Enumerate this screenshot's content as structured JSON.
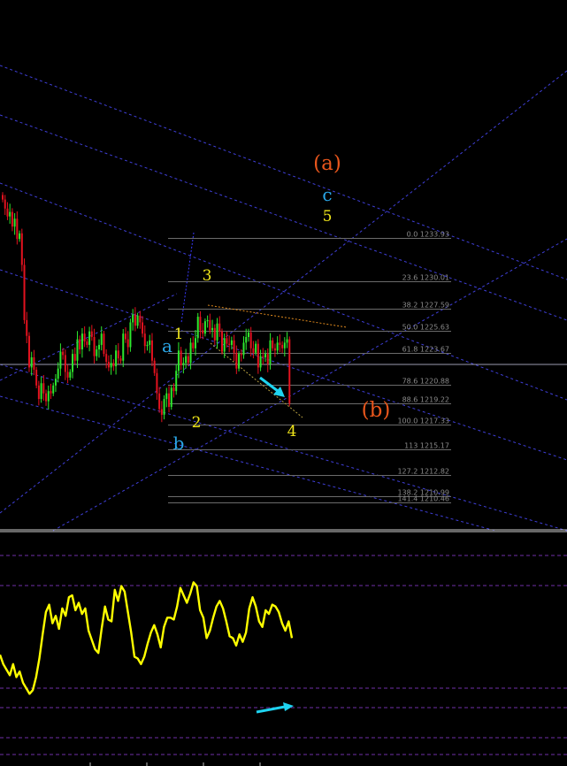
{
  "colors": {
    "background": "#000000",
    "channel": "#3f3fd8",
    "fib": "#6b6b6b",
    "hline": "#9a9ab0",
    "bull": "#2ee82e",
    "bear": "#e3121f",
    "wave_orange": "#e8561c",
    "wave_blue": "#2aa7e8",
    "wave_yellow": "#f0e61a",
    "arrow": "#1ed3f0",
    "oscillator": "#ffff00",
    "osc_level": "#7030a8"
  },
  "wave_labels": [
    {
      "id": "wave-a-outer",
      "text": "(a)",
      "color": "wave_orange"
    },
    {
      "id": "wave-b-outer",
      "text": "(b)",
      "color": "wave_orange"
    },
    {
      "id": "wave-c",
      "text": "c",
      "color": "wave_blue"
    },
    {
      "id": "wave-a",
      "text": "a",
      "color": "wave_blue"
    },
    {
      "id": "wave-b",
      "text": "b",
      "color": "wave_blue"
    },
    {
      "id": "wave-1",
      "text": "1",
      "color": "wave_yellow"
    },
    {
      "id": "wave-2",
      "text": "2",
      "color": "wave_yellow"
    },
    {
      "id": "wave-3",
      "text": "3",
      "color": "wave_yellow"
    },
    {
      "id": "wave-4",
      "text": "4",
      "color": "wave_yellow"
    },
    {
      "id": "wave-5",
      "text": "5",
      "color": "wave_yellow"
    }
  ],
  "chart_data": [
    {
      "type": "line",
      "panel": "price",
      "fib_levels": [
        {
          "ratio": "0.0",
          "price": "1233.93"
        },
        {
          "ratio": "23.6",
          "price": "1230.01"
        },
        {
          "ratio": "38.2",
          "price": "1227.59"
        },
        {
          "ratio": "50.0",
          "price": "1225.63"
        },
        {
          "ratio": "61.8",
          "price": "1223.67"
        },
        {
          "ratio": "78.6",
          "price": "1220.88"
        },
        {
          "ratio": "88.6",
          "price": "1219.22"
        },
        {
          "ratio": "100.0",
          "price": "1217.33"
        },
        {
          "ratio": "113",
          "price": "1215.17"
        },
        {
          "ratio": "127.2",
          "price": "1212.82"
        },
        {
          "ratio": "138.2",
          "price": "1210.99"
        },
        {
          "ratio": "141.4",
          "price": "1210.46"
        }
      ],
      "series": [
        {
          "values": [
            1237.3,
            1236.5,
            1235.8,
            1236.2,
            1234.9,
            1235.6,
            1233.8,
            1234.3,
            1231.5,
            1226.6,
            1225.2,
            1222.4,
            1223.3,
            1222.2,
            1220.8,
            1219.6,
            1221.0,
            1220.1,
            1219.4,
            1220.3,
            1220.1,
            1220.8,
            1221.4,
            1222.3,
            1223.8,
            1223.5,
            1222.0,
            1221.5,
            1222.0,
            1223.6,
            1223.0,
            1224.9,
            1224.0,
            1225.4,
            1224.7,
            1224.4,
            1225.6,
            1225.1,
            1223.4,
            1224.0,
            1224.4,
            1225.4,
            1223.6,
            1222.9,
            1222.4,
            1222.8,
            1222.5,
            1223.9,
            1223.2,
            1223.0,
            1225.4,
            1224.9,
            1224.2,
            1226.4,
            1227.1,
            1226.1,
            1227.0,
            1226.4,
            1225.4,
            1224.3,
            1224.4,
            1224.8,
            1223.0,
            1221.9,
            1220.1,
            1218.7,
            1218.2,
            1219.6,
            1220.1,
            1218.9,
            1220.6,
            1220.3,
            1222.1,
            1223.9,
            1222.6,
            1222.8,
            1223.4,
            1222.8,
            1224.6,
            1224.1,
            1225.0,
            1226.9,
            1225.7,
            1225.4,
            1226.5,
            1226.6,
            1225.7,
            1225.9,
            1224.8,
            1226.3,
            1225.6,
            1223.8,
            1225.0,
            1224.5,
            1224.4,
            1224.8,
            1223.7,
            1222.3,
            1223.6,
            1223.5,
            1224.6,
            1225.1,
            1225.5,
            1224.1,
            1223.7,
            1224.5,
            1222.4,
            1223.4,
            1223.3,
            1223.6,
            1222.7,
            1224.8,
            1224.1,
            1223.9,
            1224.6,
            1224.4,
            1224.1,
            1224.6,
            1224.9,
            1219.2
          ]
        },
        {
          "values": [
            57,
            52,
            49,
            46,
            52,
            45,
            48,
            42,
            39,
            36,
            38,
            45,
            55,
            68,
            80,
            84,
            74,
            78,
            71,
            82,
            78,
            88,
            89,
            81,
            85,
            79,
            82,
            70,
            65,
            60,
            58,
            71,
            83,
            76,
            75,
            92,
            86,
            94,
            91,
            80,
            69,
            56,
            55,
            52,
            56,
            63,
            69,
            73,
            68,
            61,
            72,
            77,
            77,
            76,
            83,
            93,
            89,
            85,
            90,
            96,
            94,
            81,
            77,
            66,
            70,
            77,
            83,
            86,
            82,
            75,
            67,
            66,
            62,
            68,
            64,
            69,
            82,
            88,
            83,
            75,
            72,
            81,
            79,
            84,
            83,
            80,
            74,
            70,
            75,
            66
          ]
        }
      ]
    }
  ]
}
